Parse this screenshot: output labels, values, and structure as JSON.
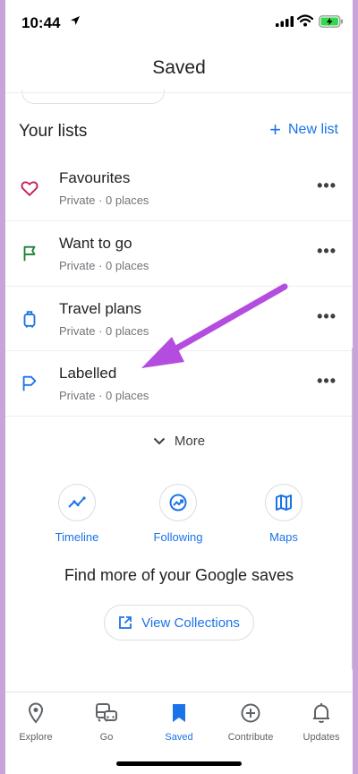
{
  "status_bar": {
    "time": "10:44"
  },
  "header": {
    "title": "Saved"
  },
  "lists_section": {
    "title": "Your lists",
    "new_list_label": "New list"
  },
  "lists": [
    {
      "name": "Favourites",
      "meta": "Private · 0 places",
      "icon": "heart-icon",
      "color": "#c2185b"
    },
    {
      "name": "Want to go",
      "meta": "Private · 0 places",
      "icon": "flag-icon",
      "color": "#188038"
    },
    {
      "name": "Travel plans",
      "meta": "Private · 0 places",
      "icon": "suitcase-icon",
      "color": "#1a73e8"
    },
    {
      "name": "Labelled",
      "meta": "Private · 0 places",
      "icon": "label-flag-icon",
      "color": "#1a73e8"
    }
  ],
  "more_label": "More",
  "shortcuts": [
    {
      "label": "Timeline",
      "icon": "timeline-icon"
    },
    {
      "label": "Following",
      "icon": "following-icon"
    },
    {
      "label": "Maps",
      "icon": "map-icon"
    }
  ],
  "find_more": {
    "text": "Find more of your Google saves",
    "button_label": "View Collections"
  },
  "bottom_nav": [
    {
      "label": "Explore",
      "icon": "pin-icon",
      "active": false
    },
    {
      "label": "Go",
      "icon": "commute-icon",
      "active": false
    },
    {
      "label": "Saved",
      "icon": "bookmark-icon",
      "active": true
    },
    {
      "label": "Contribute",
      "icon": "add-circle-icon",
      "active": false
    },
    {
      "label": "Updates",
      "icon": "bell-icon",
      "active": false
    }
  ],
  "colors": {
    "accent": "#1a73e8",
    "annotation": "#b44ce0"
  }
}
